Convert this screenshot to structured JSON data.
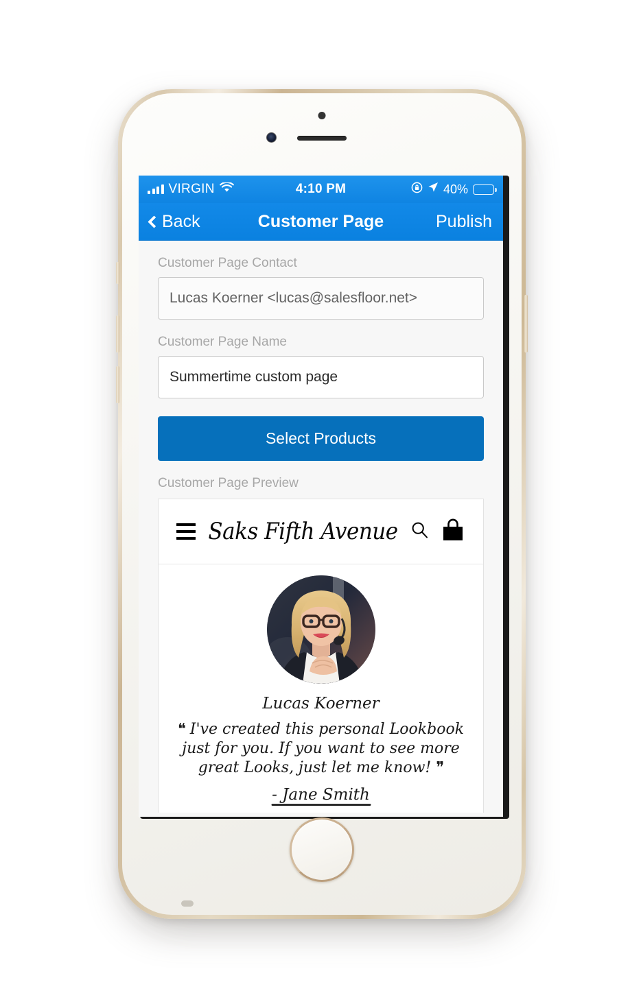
{
  "status_bar": {
    "signal_icon": "signal-bars-icon",
    "carrier": "VIRGIN",
    "wifi_icon": "wifi-icon",
    "time": "4:10 PM",
    "rotation_lock_icon": "rotation-lock-icon",
    "location_icon": "location-arrow-icon",
    "battery_percent": "40%",
    "battery_level": 40,
    "battery_color": "#ffcb00"
  },
  "nav_bar": {
    "back_label": "Back",
    "back_icon": "chevron-left-icon",
    "title": "Customer Page",
    "action_label": "Publish",
    "background_color": "#0a81e0"
  },
  "form": {
    "contact_label": "Customer Page Contact",
    "contact_value": "Lucas Koerner <lucas@salesfloor.net>",
    "contact_placeholder": "Customer Page Contact",
    "name_label": "Customer Page Name",
    "name_value": "Summertime custom page",
    "name_placeholder": "Customer Page Name",
    "select_products_label": "Select Products",
    "select_products_color": "#0670bb",
    "preview_label": "Customer Page Preview"
  },
  "preview": {
    "menu_icon": "hamburger-menu-icon",
    "brand_logo_text": "Saks Fifth Avenue",
    "search_icon": "search-icon",
    "bag_icon": "shopping-bag-icon",
    "avatar_icon": "avatar-photo",
    "rep_name": "Lucas Koerner",
    "quote_open": "❝",
    "quote_text": "I've created this personal Lookbook just for you. If you want to see more great Looks, just let me know!",
    "quote_close": "❞",
    "signature": "- Jane Smith"
  }
}
